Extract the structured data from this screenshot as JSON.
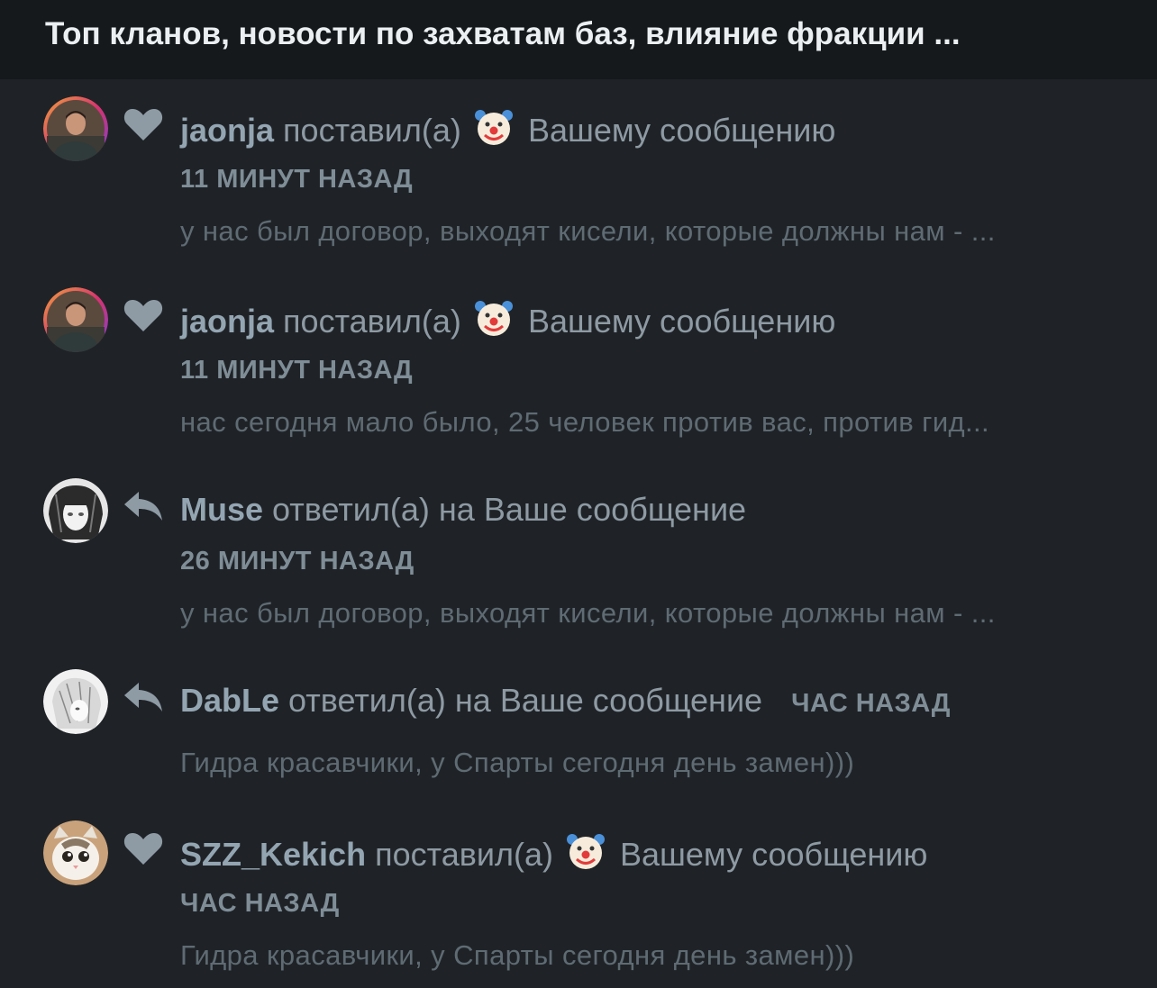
{
  "header": {
    "title": "Топ кланов, новости по захватам баз, влияние фракции ..."
  },
  "notifications": [
    {
      "user": "jaonja",
      "action_before": "поставил(а)",
      "reaction": "clown-emoji",
      "action_after": "Вашему сообщению",
      "time": "11 МИНУТ НАЗАД",
      "snippet": "у нас был договор, выходят кисели, которые должны нам - ...",
      "icon": "heart-icon"
    },
    {
      "user": "jaonja",
      "action_before": "поставил(а)",
      "reaction": "clown-emoji",
      "action_after": "Вашему сообщению",
      "time": "11 МИНУТ НАЗАД",
      "snippet": "нас сегодня мало было, 25 человек против вас, против гид...",
      "icon": "heart-icon"
    },
    {
      "user": "Muse",
      "action": "ответил(а) на Ваше сообщение",
      "time": "26 МИНУТ НАЗАД",
      "snippet": "у нас был договор, выходят кисели, которые должны нам - ...",
      "icon": "reply-icon"
    },
    {
      "user": "DabLe",
      "action": "ответил(а) на Ваше сообщение",
      "time": "ЧАС НАЗАД",
      "snippet": "Гидра красавчики, у Спарты сегодня день замен)))",
      "icon": "reply-icon"
    },
    {
      "user": "SZZ_Kekich",
      "action_before": "поставил(а)",
      "reaction": "clown-emoji",
      "action_after": "Вашему сообщению",
      "time": "ЧАС НАЗАД",
      "snippet": "Гидра красавчики, у Спарты сегодня день замен)))",
      "icon": "heart-icon"
    }
  ],
  "colors": {
    "background": "#1f2327",
    "header_background": "#16191c",
    "username": "#94a5b2",
    "text": "#8e9aa3",
    "snippet": "#5f6b73",
    "icon": "#8e9ba5"
  }
}
